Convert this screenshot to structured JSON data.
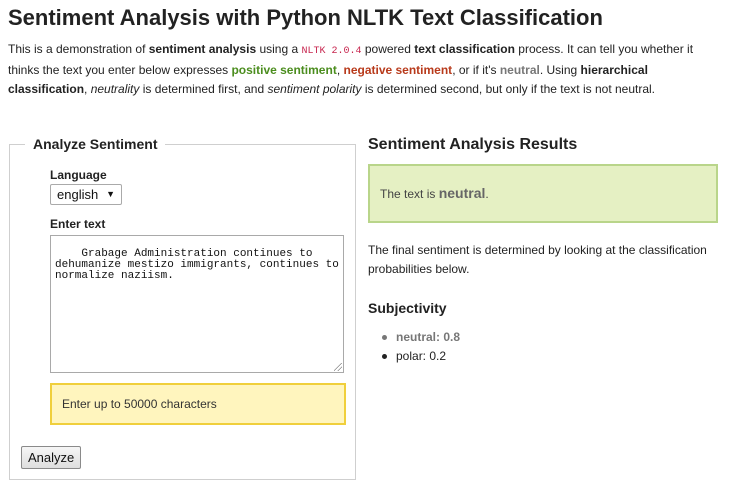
{
  "page": {
    "title": "Sentiment Analysis with Python NLTK Text Classification"
  },
  "intro": {
    "p1": "This is a demonstration of ",
    "b1": "sentiment analysis",
    "p2": " using a ",
    "code": "NLTK 2.0.4",
    "p3": " powered ",
    "b2": "text classification",
    "p4": " process. It can tell you whether it thinks the text you enter below expresses ",
    "pos": "positive sentiment",
    "p5": ", ",
    "neg": "negative sentiment",
    "p6": ", or if it's ",
    "neu": "neutral",
    "p7": ". Using ",
    "b3": "hierarchical classification",
    "p8": ", ",
    "i1": "neutrality",
    "p9": " is determined first, and ",
    "i2": "sentiment polarity",
    "p10": " is determined second, but only if the text is not neutral."
  },
  "form": {
    "legend": "Analyze Sentiment",
    "language_label": "Language",
    "language_value": "english",
    "text_label": "Enter text",
    "text_value": "Grabage Administration continues to dehumanize mestizo immigrants, continues to normalize naziism.",
    "char_hint": "Enter up to 50000 characters",
    "analyze_label": "Analyze"
  },
  "results": {
    "title": "Sentiment Analysis Results",
    "prefix": "The text is ",
    "verdict": "neutral",
    "suffix": ".",
    "final_text": "The final sentiment is determined by looking at the classification probabilities below.",
    "subjectivity_title": "Subjectivity",
    "probabilities": [
      {
        "label": "neutral: 0.8"
      },
      {
        "label": "polar: 0.2"
      }
    ]
  },
  "colors": {
    "positive": "#4b8d1e",
    "negative": "#b83a1b",
    "neutral": "#777777",
    "result_bg": "#e5f0c3",
    "hint_bg": "#fff5be"
  },
  "icons": {
    "select_arrow": "chevron-down-icon"
  }
}
